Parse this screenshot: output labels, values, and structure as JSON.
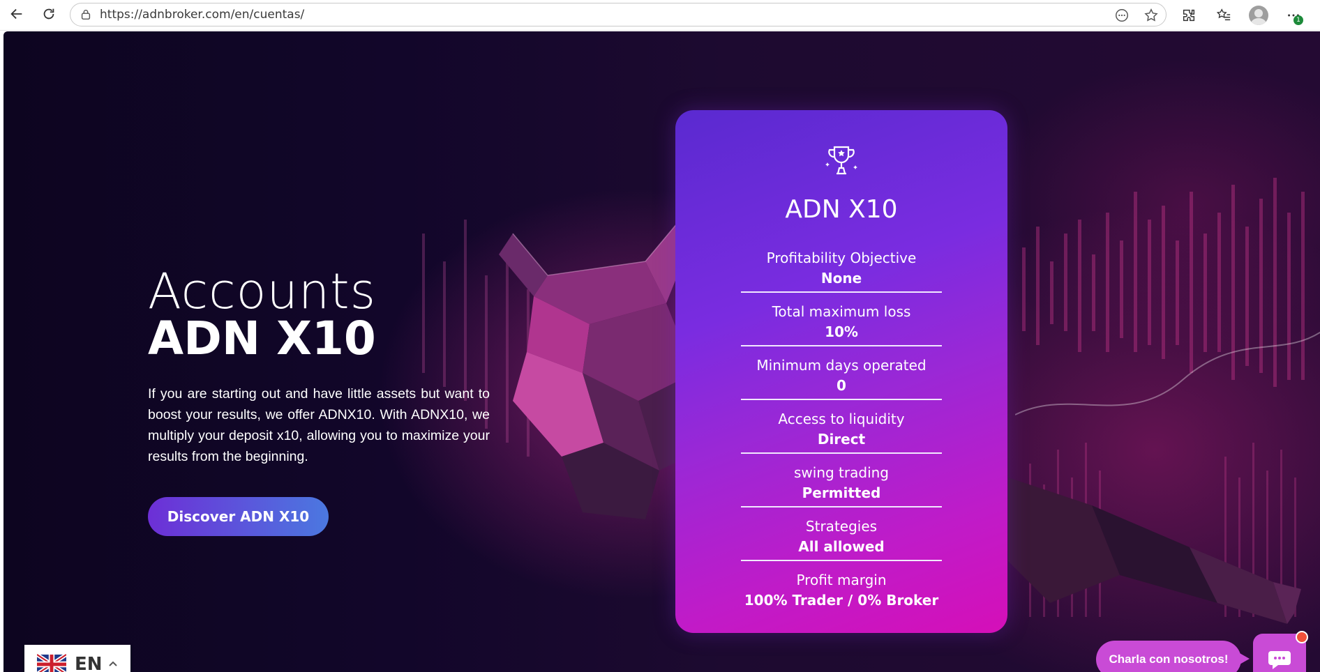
{
  "browser": {
    "url": "https://adnbroker.com/en/cuentas/",
    "icons": [
      "back-icon",
      "reload-icon",
      "site-info-icon",
      "reading-mode-icon",
      "favorite-star-icon",
      "extensions-icon",
      "favorites-list-icon",
      "profile-avatar",
      "more-menu-icon"
    ],
    "notification_badge": "1"
  },
  "hero": {
    "title_light": "Accounts",
    "title_bold": "ADN X10",
    "description": "If you are starting out and have little assets but want to boost your results, we offer ADNX10. With ADNX10, we multiply your deposit x10, allowing you to maximize your results from the beginning.",
    "cta_label": "Discover ADN X10"
  },
  "card": {
    "title": "ADN X10",
    "icon": "trophy-icon",
    "features": [
      {
        "label": "Profitability Objective",
        "value": "None"
      },
      {
        "label": "Total maximum loss",
        "value": "10%"
      },
      {
        "label": "Minimum days operated",
        "value": "0"
      },
      {
        "label": "Access to liquidity",
        "value": "Direct"
      },
      {
        "label": "swing trading",
        "value": "Permitted"
      },
      {
        "label": "Strategies",
        "value": "All allowed"
      },
      {
        "label": "Profit margin",
        "value": "100% Trader / 0% Broker"
      }
    ]
  },
  "language": {
    "code": "EN",
    "flag": "uk-flag-icon"
  },
  "chat": {
    "bubble_text": "Charla con nosotros!",
    "icon": "chat-icon"
  },
  "colors": {
    "page_bg": "#12062a",
    "card_start": "#5a2ad0",
    "card_end": "#d50fb8",
    "cta_start": "#6d2fd6",
    "cta_end": "#4b78e0",
    "chat": "#c94bd6"
  }
}
